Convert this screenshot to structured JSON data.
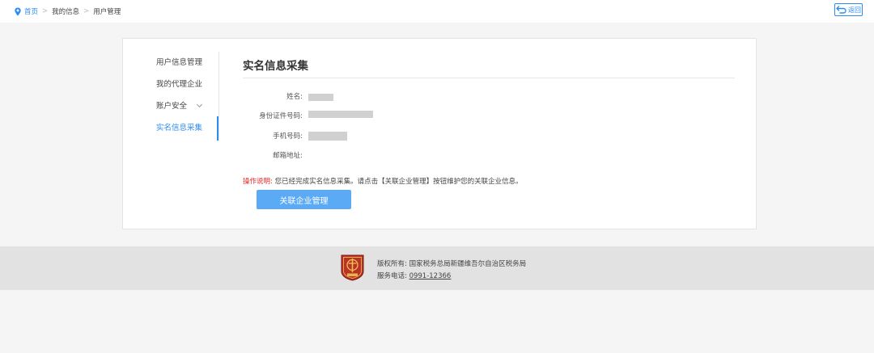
{
  "breadcrumb": {
    "home": "首页",
    "separator": ">",
    "level1": "我的信息",
    "level2": "用户管理"
  },
  "back_button": {
    "label": "返回"
  },
  "sidebar": {
    "items": [
      {
        "label": "用户信息管理"
      },
      {
        "label": "我的代理企业"
      },
      {
        "label": "账户安全"
      },
      {
        "label": "实名信息采集"
      }
    ]
  },
  "main": {
    "title": "实名信息采集",
    "fields": [
      {
        "label": "姓名:"
      },
      {
        "label": "身份证件号码:"
      },
      {
        "label": "手机号码:"
      },
      {
        "label": "邮箱地址:"
      }
    ],
    "notice_label": "操作说明:",
    "notice_text": "您已经完成实名信息采集。请点击【关联企业管理】按钮维护您的关联企业信息。",
    "action_button": "关联企业管理"
  },
  "footer": {
    "copyright_label": "版权所有:",
    "copyright_value": "国家税务总局新疆维吾尔自治区税务局",
    "phone_label": "服务电话:",
    "phone_value": "0991-12366"
  },
  "colors": {
    "accent": "#2d8cf0",
    "button": "#5aaaf5",
    "notice_red": "#e52a2a",
    "footer_bg": "#e2e2e2",
    "page_bg": "#f5f5f5"
  },
  "icons": {
    "breadcrumb": "location-pin-icon",
    "back": "return-arrow-icon",
    "dropdown": "chevron-down-icon",
    "footer_logo": "tax-bureau-emblem-icon"
  }
}
